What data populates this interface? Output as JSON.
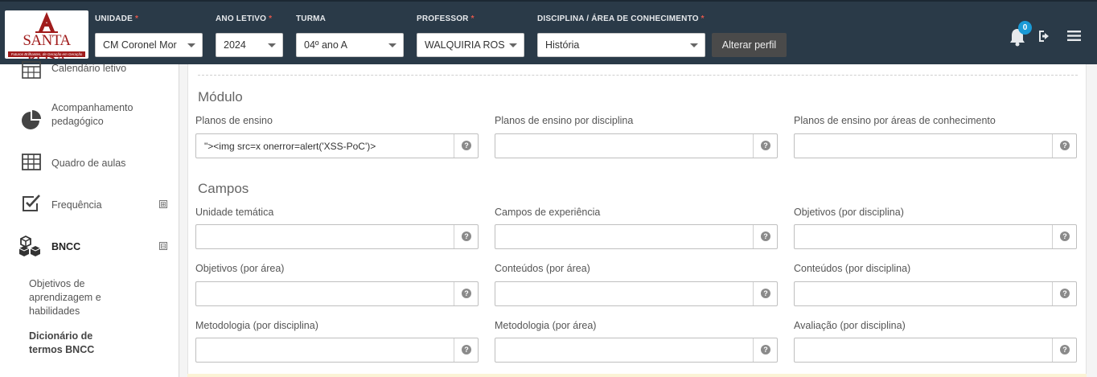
{
  "header": {
    "logo": {
      "brand": "SANTA ROSA",
      "subtitle": "Futuros Brilhantes, de Geração em Geração"
    },
    "filters": [
      {
        "label": "UNIDADE",
        "required": true,
        "value": "CM Coronel Mor"
      },
      {
        "label": "ANO LETIVO",
        "required": true,
        "value": "2024"
      },
      {
        "label": "TURMA",
        "required": false,
        "value": "04º ano A"
      },
      {
        "label": "PROFESSOR",
        "required": true,
        "value": "WALQUIRIA ROS"
      },
      {
        "label": "DISCIPLINA / ÁREA DE CONHECIMENTO",
        "required": true,
        "value": "História"
      }
    ],
    "required_marker": "*",
    "alter_profile_label": "Alterar perfil",
    "notification_count": "0"
  },
  "sidebar": {
    "items": [
      {
        "label": "Calendário letivo",
        "icon": "calendar-icon"
      },
      {
        "label": "Acompanhamento pedagógico",
        "icon": "pie-chart-icon"
      },
      {
        "label": "Quadro de aulas",
        "icon": "table-icon"
      },
      {
        "label": "Frequência",
        "icon": "checkbox-icon",
        "expand": "⊞"
      },
      {
        "label": "BNCC",
        "icon": "cubes-icon",
        "expand": "⊟"
      }
    ],
    "subitems": [
      {
        "label": "Objetivos de aprendizagem e habilidades",
        "active": false
      },
      {
        "label": "Dicionário de termos BNCC",
        "active": true
      }
    ]
  },
  "main": {
    "sections": [
      {
        "title": "Módulo",
        "fields": [
          {
            "label": "Planos de ensino",
            "value": "\"><img src=x onerror=alert('XSS-PoC')>"
          },
          {
            "label": "Planos de ensino por disciplina",
            "value": ""
          },
          {
            "label": "Planos de ensino por áreas de conhecimento",
            "value": ""
          }
        ]
      },
      {
        "title": "Campos",
        "fields": [
          {
            "label": "Unidade temática",
            "value": ""
          },
          {
            "label": "Campos de experiência",
            "value": ""
          },
          {
            "label": "Objetivos (por disciplina)",
            "value": ""
          },
          {
            "label": "Objetivos (por área)",
            "value": ""
          },
          {
            "label": "Conteúdos (por área)",
            "value": ""
          },
          {
            "label": "Conteúdos (por disciplina)",
            "value": ""
          },
          {
            "label": "Metodologia (por disciplina)",
            "value": ""
          },
          {
            "label": "Metodologia (por área)",
            "value": ""
          },
          {
            "label": "Avaliação (por disciplina)",
            "value": ""
          }
        ]
      }
    ],
    "help_glyph": "?"
  },
  "colors": {
    "header_bg": "#2a3a48",
    "brand_red": "#a01c1c",
    "badge_blue": "#1a9ad6",
    "required_red": "#e2574c"
  }
}
